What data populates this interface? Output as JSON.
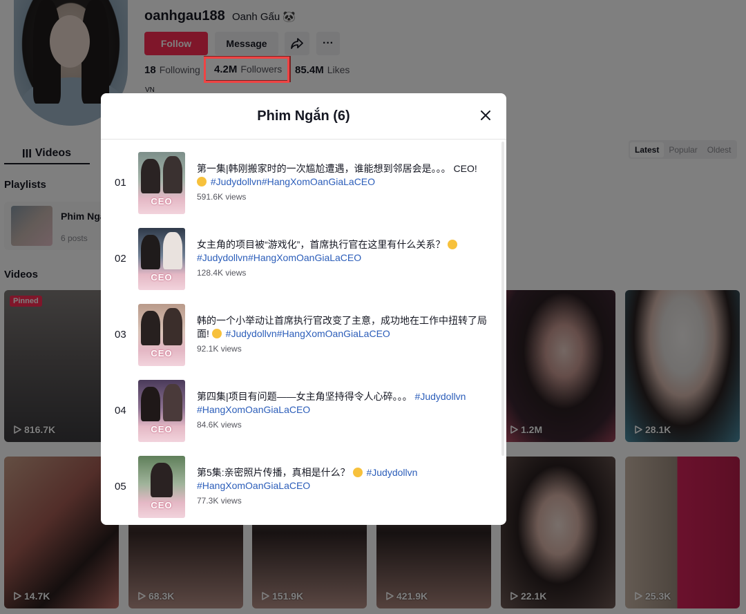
{
  "profile": {
    "username": "oanhgau188",
    "nickname": "Oanh Gấu 🐼",
    "follow_label": "Follow",
    "message_label": "Message",
    "more_label": "···",
    "following_count": "18",
    "following_label": "Following",
    "followers_count": "4.2M",
    "followers_label": "Followers",
    "likes_count": "85.4M",
    "likes_label": "Likes",
    "region": "VN"
  },
  "tabs": {
    "videos_label": "Videos",
    "sort": [
      "Latest",
      "Popular",
      "Oldest"
    ]
  },
  "playlists": {
    "heading": "Playlists",
    "card_name": "Phim Ngắn",
    "card_count": "6 posts"
  },
  "videos": {
    "heading": "Videos",
    "pinned_label": "Pinned",
    "items": [
      {
        "views": "816.7K"
      },
      {
        "views": "1.2M"
      },
      {
        "views": "28.1K"
      },
      {
        "views": "14.7K"
      },
      {
        "views": "68.3K"
      },
      {
        "views": "151.9K"
      },
      {
        "views": "421.9K"
      },
      {
        "views": "22.1K"
      },
      {
        "views": "25.3K"
      }
    ]
  },
  "modal": {
    "title": "Phim Ngắn (6)",
    "items": [
      {
        "num": "01",
        "text": "第一集|韩刚搬家时的一次尴尬遭遇，谁能想到邻居会是。。。 CEO!",
        "tags": "#Judydollvn#HangXomOanGiaLaCEO",
        "views": "591.6K views"
      },
      {
        "num": "02",
        "text": "女主角的项目被“游戏化”，首席执行官在这里有什么关系？",
        "tags": "#Judydollvn#HangXomOanGiaLaCEO",
        "views": "128.4K views"
      },
      {
        "num": "03",
        "text": "韩的一个小举动让首席执行官改变了主意，成功地在工作中扭转了局面!",
        "tags": "#Judydollvn#HangXomOanGiaLaCEO",
        "views": "92.1K views"
      },
      {
        "num": "04",
        "text": "第四集|项目有问题——女主角坚持得令人心碎。。。",
        "tags": "#Judydollvn",
        "tags2": "#HangXomOanGiaLaCEO",
        "views": "84.6K views"
      },
      {
        "num": "05",
        "text": "第5集:亲密照片传播，真相是什么？",
        "tags": "#Judydollvn",
        "tags2": "#HangXomOanGiaLaCEO",
        "views": "77.3K views"
      }
    ],
    "thumb_label": "CEO"
  },
  "colors": {
    "brand": "#fe2c55",
    "hashtag": "#2b5db9",
    "highlight_box": "#ef4444"
  }
}
